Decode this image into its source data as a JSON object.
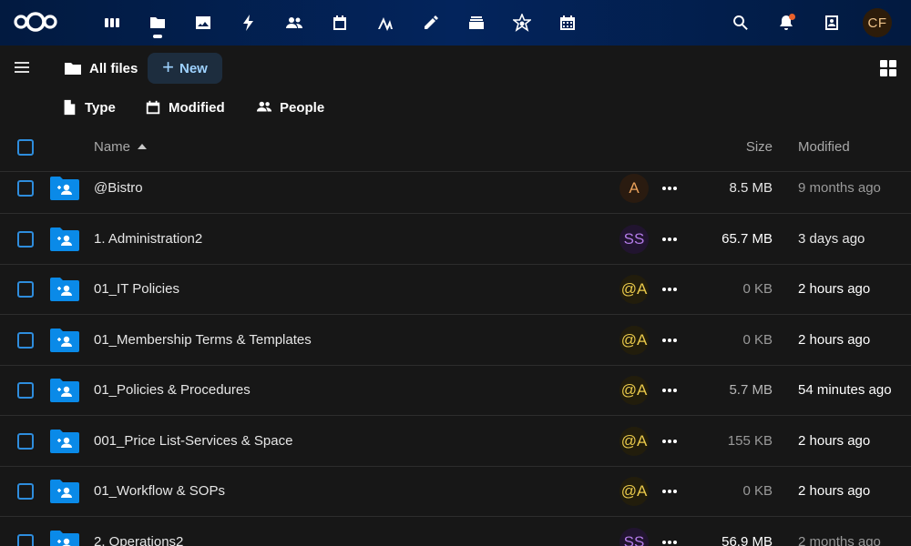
{
  "topbar": {
    "apps": [
      {
        "name": "dashboard-icon",
        "active": false
      },
      {
        "name": "files-icon",
        "active": true
      },
      {
        "name": "photos-icon",
        "active": false
      },
      {
        "name": "activity-icon",
        "active": false
      },
      {
        "name": "contacts-icon",
        "active": false
      },
      {
        "name": "calendar-icon",
        "active": false
      },
      {
        "name": "analytics-icon",
        "active": false
      },
      {
        "name": "notes-icon",
        "active": false
      },
      {
        "name": "deck-icon",
        "active": false
      },
      {
        "name": "talk-icon",
        "active": false
      },
      {
        "name": "calendar-grid-icon",
        "active": false
      }
    ],
    "user_initials": "CF"
  },
  "toolbar": {
    "breadcrumb_label": "All files",
    "new_label": "New"
  },
  "filters": [
    {
      "label": "Type",
      "icon": "file-icon"
    },
    {
      "label": "Modified",
      "icon": "calendar-icon"
    },
    {
      "label": "People",
      "icon": "people-icon"
    }
  ],
  "columns": {
    "name": "Name",
    "size": "Size",
    "modified": "Modified"
  },
  "files": [
    {
      "name": "@Bistro",
      "share": "A",
      "share_color": "#e8a05a",
      "share_bg": "#2a1b10",
      "size": "8.5 MB",
      "size_color": "#e6e6e6",
      "modified": "9 months ago",
      "mod_color": "#9a9a9a"
    },
    {
      "name": "1. Administration2",
      "share": "SS",
      "share_color": "#b27be6",
      "share_bg": "#21142f",
      "size": "65.7 MB",
      "size_color": "#ffffff",
      "modified": "3 days ago",
      "mod_color": "#e6e6e6"
    },
    {
      "name": "01_IT Policies",
      "share": "@A",
      "share_color": "#e8c84a",
      "share_bg": "#221d0c",
      "size": "0 KB",
      "size_color": "#9a9a9a",
      "modified": "2 hours ago",
      "mod_color": "#ffffff"
    },
    {
      "name": "01_Membership Terms & Templates",
      "share": "@A",
      "share_color": "#e8c84a",
      "share_bg": "#221d0c",
      "size": "0 KB",
      "size_color": "#9a9a9a",
      "modified": "2 hours ago",
      "mod_color": "#ffffff"
    },
    {
      "name": "01_Policies & Procedures",
      "share": "@A",
      "share_color": "#e8c84a",
      "share_bg": "#221d0c",
      "size": "5.7 MB",
      "size_color": "#b8b8b8",
      "modified": "54 minutes ago",
      "mod_color": "#ffffff"
    },
    {
      "name": "001_Price List-Services & Space",
      "share": "@A",
      "share_color": "#e8c84a",
      "share_bg": "#221d0c",
      "size": "155 KB",
      "size_color": "#9a9a9a",
      "modified": "2 hours ago",
      "mod_color": "#ffffff"
    },
    {
      "name": "01_Workflow & SOPs",
      "share": "@A",
      "share_color": "#e8c84a",
      "share_bg": "#221d0c",
      "size": "0 KB",
      "size_color": "#9a9a9a",
      "modified": "2 hours ago",
      "mod_color": "#ffffff"
    },
    {
      "name": "2. Operations2",
      "share": "SS",
      "share_color": "#b27be6",
      "share_bg": "#21142f",
      "size": "56.9 MB",
      "size_color": "#ffffff",
      "modified": "2 months ago",
      "mod_color": "#9a9a9a"
    }
  ]
}
